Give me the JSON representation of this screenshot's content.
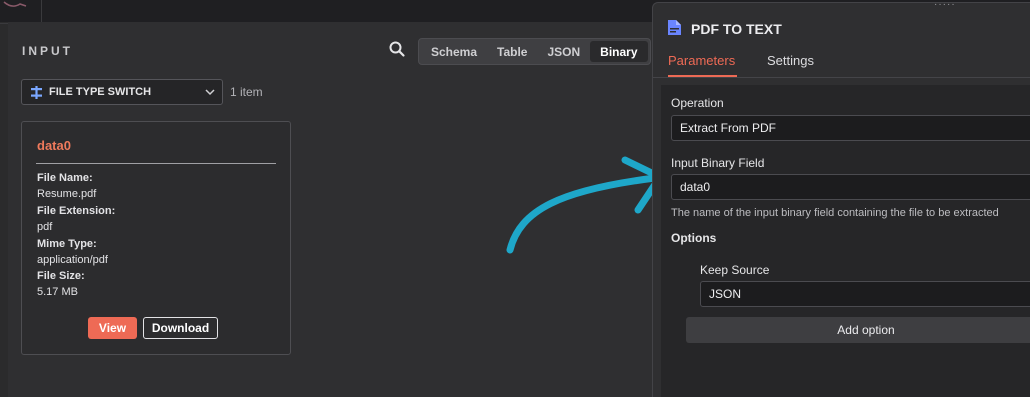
{
  "input_panel": {
    "title": "INPUT",
    "view_tabs": [
      "Schema",
      "Table",
      "JSON",
      "Binary"
    ],
    "active_tab": "Binary",
    "node_select": "FILE TYPE SWITCH",
    "item_count": "1 item",
    "card": {
      "title": "data0",
      "file_name_label": "File Name:",
      "file_name": "Resume.pdf",
      "file_extension_label": "File Extension:",
      "file_extension": "pdf",
      "mime_type_label": "Mime Type:",
      "mime_type": "application/pdf",
      "file_size_label": "File Size:",
      "file_size": "5.17 MB",
      "view_label": "View",
      "download_label": "Download"
    }
  },
  "node_panel": {
    "drag_handle": "·····",
    "title": "PDF TO TEXT",
    "tabs": {
      "parameters": "Parameters",
      "settings": "Settings"
    },
    "operation_label": "Operation",
    "operation_value": "Extract From PDF",
    "binary_field_label": "Input Binary Field",
    "binary_field_value": "data0",
    "binary_field_hint": "The name of the input binary field containing the file to be extracted",
    "options_label": "Options",
    "keep_source_label": "Keep Source",
    "keep_source_value": "JSON",
    "add_option_label": "Add option"
  },
  "colors": {
    "accent": "#ee6a55",
    "annotation_arrow": "#1ea7c9",
    "node_icon": "#6a85ff"
  },
  "icons": {
    "search": "search-icon",
    "node_switch": "switch-icon",
    "dropdown": "chevron-down-icon",
    "node_type": "pdf-file-icon"
  }
}
